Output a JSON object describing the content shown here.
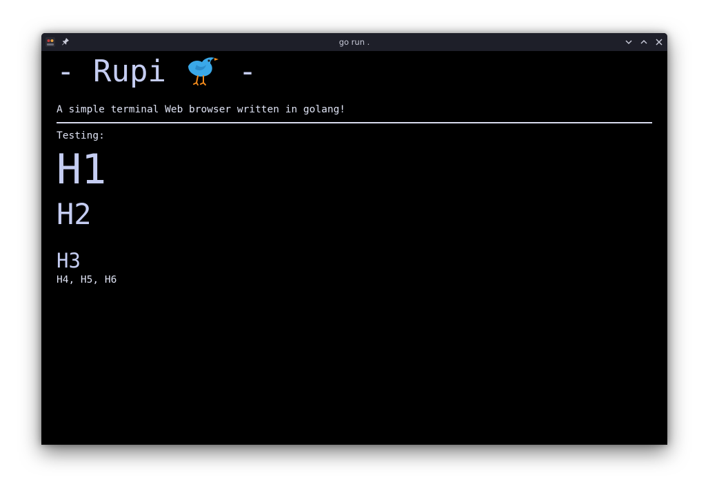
{
  "window": {
    "title": "go run ."
  },
  "icons": {
    "app": "terminal-app-icon",
    "pin": "pin-icon",
    "minimize": "chevron-down-icon",
    "maximize": "chevron-up-icon",
    "close": "close-icon",
    "bird": "bird-icon"
  },
  "page": {
    "banner_left": "- Rupi ",
    "banner_right": " -",
    "subtitle": "A simple terminal Web browser written in golang!",
    "testing_label": "Testing:",
    "h1": "H1",
    "h2": "H2",
    "h3": "H3",
    "h456": "H4, H5, H6"
  },
  "colors": {
    "terminal_bg": "#000000",
    "titlebar_bg": "#1e1f29",
    "text": "#c5cdf2",
    "bird_blue": "#3aa8e8",
    "bird_orange": "#f28a1c"
  }
}
